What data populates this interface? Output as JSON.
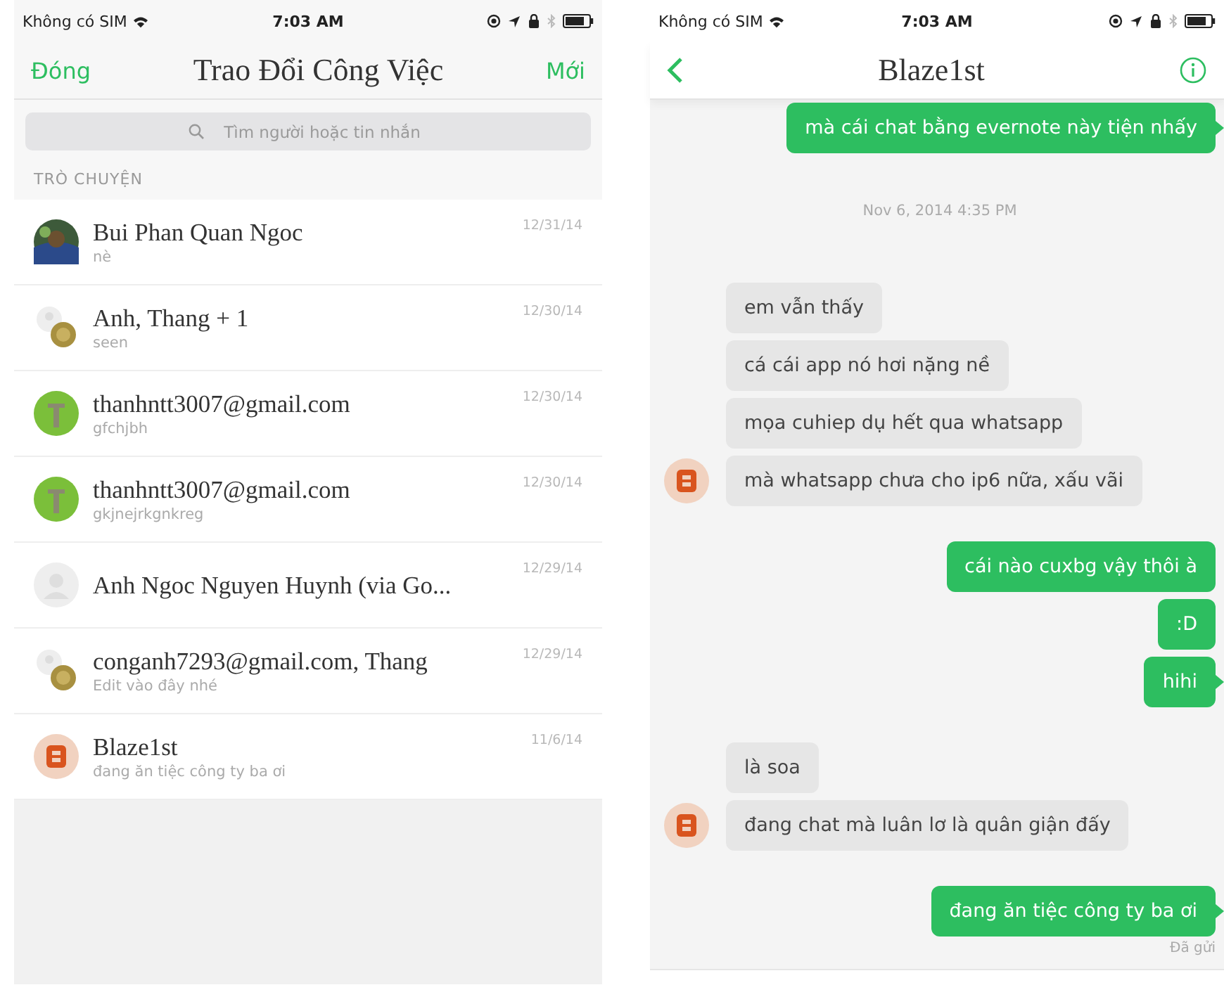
{
  "left_screen": {
    "status_bar": {
      "carrier": "Không có SIM",
      "time": "7:03 AM"
    },
    "nav": {
      "left": "Đóng",
      "title": "Trao Đổi Công Việc",
      "right": "Mới"
    },
    "search": {
      "placeholder": "Tìm người hoặc tin nhắn"
    },
    "section": "TRÒ CHUYỆN",
    "conversations": [
      {
        "name": "Bui Phan Quan Ngoc",
        "preview": "nè",
        "date": "12/31/14",
        "avatar": {
          "kind": "photo"
        }
      },
      {
        "name": "Anh, Thang + 1",
        "preview": "seen",
        "date": "12/30/14",
        "avatar": {
          "kind": "group"
        }
      },
      {
        "name": "thanhntt3007@gmail.com",
        "preview": "gfchjbh",
        "date": "12/30/14",
        "avatar": {
          "kind": "green"
        }
      },
      {
        "name": "thanhntt3007@gmail.com",
        "preview": "gkjnejrkgnkreg",
        "date": "12/30/14",
        "avatar": {
          "kind": "green"
        }
      },
      {
        "name": "Anh Ngoc Nguyen Huynh (via Go...",
        "date": "12/29/14",
        "avatar": {
          "kind": "blank"
        }
      },
      {
        "name": "conganh7293@gmail.com, Thang",
        "preview": "Edit vào đây nhé",
        "date": "12/29/14",
        "avatar": {
          "kind": "group"
        }
      },
      {
        "name": "Blaze1st",
        "preview": "đang ăn tiệc công ty ba ơi",
        "date": "11/6/14",
        "avatar": {
          "kind": "orange"
        }
      }
    ]
  },
  "right_screen": {
    "status_bar": {
      "carrier": "Không có SIM",
      "time": "7:03 AM"
    },
    "nav": {
      "title": "Blaze1st"
    },
    "messages": [
      {
        "kind": "sent",
        "text": "mà cái chat bằng evernote này tiện nhấy",
        "tail": true
      },
      {
        "kind": "timestamp",
        "text": "Nov 6, 2014 4:35 PM"
      },
      {
        "kind": "received",
        "text": "em vẫn thấy",
        "avatar": false
      },
      {
        "kind": "received",
        "text": "cá cái app nó hơi nặng nề",
        "avatar": false
      },
      {
        "kind": "received",
        "text": "mọa cuhiep dụ hết qua whatsapp",
        "avatar": false
      },
      {
        "kind": "received",
        "text": "mà whatsapp chưa cho ip6 nữa, xấu vãi",
        "avatar": true
      },
      {
        "kind": "sent",
        "text": "cái nào cuxbg vậy thôi à",
        "tail": false
      },
      {
        "kind": "sent",
        "text": ":D",
        "tail": false
      },
      {
        "kind": "sent",
        "text": "hihi",
        "tail": true
      },
      {
        "kind": "received",
        "text": "là soa",
        "avatar": false
      },
      {
        "kind": "received",
        "text": "đang chat mà luân lơ là quân giận đấy",
        "avatar": true
      },
      {
        "kind": "sent",
        "text": "đang ăn tiệc công ty ba ơi",
        "tail": true
      },
      {
        "kind": "status",
        "text": "Đã gửi"
      }
    ]
  }
}
